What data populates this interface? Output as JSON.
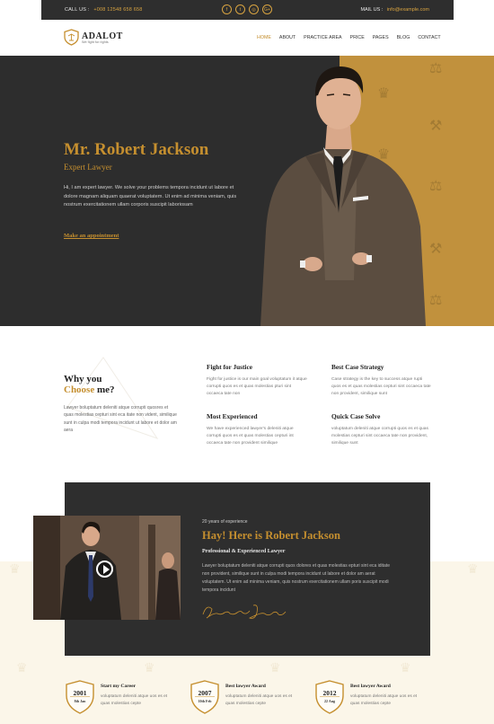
{
  "topbar": {
    "call_label": "CALL US :",
    "phone": "+008 12548 658 658",
    "social_icons": [
      {
        "name": "facebook-icon",
        "glyph": "f"
      },
      {
        "name": "twitter-icon",
        "glyph": "t"
      },
      {
        "name": "instagram-icon",
        "glyph": "◎"
      },
      {
        "name": "google-plus-icon",
        "glyph": "G+"
      }
    ],
    "mail_label": "MAIL US :",
    "email": "info@example.com"
  },
  "brand": {
    "name": "ADALOT",
    "tagline": "We fight for rights",
    "accent_color": "#c58f2f",
    "dark_color": "#2d2d2d"
  },
  "nav": {
    "items": [
      "HOME",
      "ABOUT",
      "PRACTICE AREA",
      "PRICE",
      "PAGES",
      "BLOG",
      "CONTACT"
    ],
    "active": "HOME"
  },
  "hero": {
    "name": "Mr. Robert Jackson",
    "role": "Expert Lawyer",
    "description": "Hi, I am expert lawyer. We solve your problems tempora incidunt ut labore et dolore magnam aliquam quaerat voluptatem. Ut enim ad minima veniam, quis nostrum exercitationem ullam corporis suscipit laboriosam",
    "cta": "Make an appointment"
  },
  "why": {
    "title_part1": "Why you",
    "title_gold": "Choose",
    "title_part2": "me?",
    "text": "Lawyer boluptatum deleniti atque corrupti quosres et quas molestias cepturi sint eca itate non vident, similique sunt in culpa modi tempora incidunt ut labore et dolor am aera",
    "features": [
      {
        "title": "Fight for Justice",
        "text": "Fight for justice is our main goal voluptatum it atque corrupti quos es et quas molestias pturi sint occaeca tate non"
      },
      {
        "title": "Best Case Strategy",
        "text": "Case strategy is the key to success atque rupti quos es et quas molestias cepturi sint occaeca tate non provident, similique sunt"
      },
      {
        "title": "Most Experienced",
        "text": "We have experienced lawyer's deleniti atque corrupti quos es et quas molestias cepturi int occaeca tate non provident similique"
      },
      {
        "title": "Quick Case Solve",
        "text": "voluptatum deleniti atque corrupti quos es et quas molestias cepturi sint occaeca tate non provident, similique sunt"
      }
    ]
  },
  "about": {
    "experience": "20 years of experience",
    "title": "Hay! Here is Robert Jackson",
    "subtitle": "Professional & Experienced Lawyer",
    "text": "Lawyer boluptatum deleniti atque corrupti quos dolores et quas molestias epturi sint eca iditate non provident, similique sunt in culpa modi tempora incidunt ut labore et dolor am aerat voluptatem. Ut enim ad minima veniam, quis nostrum exercitationem ullam poris suscipit modi tempora incidunt",
    "signature": "Robert Jackson"
  },
  "awards": [
    {
      "year": "2001",
      "date": "8th Jan",
      "title": "Start my Career",
      "text": "voluptatum deleniti atque uos es et quas molestias cepte"
    },
    {
      "year": "2007",
      "date": "10th Feb",
      "title": "Best lawyer Award",
      "text": "voluptatum deleniti atque uos es et quas molestias cepte"
    },
    {
      "year": "2012",
      "date": "22 Aug",
      "title": "Best lawyer Award",
      "text": "voluptatum deleniti atque uos es et quas molestias cepte"
    }
  ]
}
